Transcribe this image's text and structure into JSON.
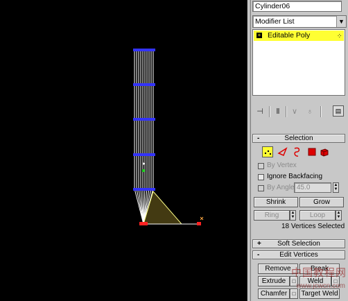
{
  "object_name": "Cylinder06",
  "modifier_list": {
    "label": "Modifier List",
    "arrow": "▼"
  },
  "stack": {
    "items": [
      {
        "label": "Editable Poly",
        "selected": true
      }
    ]
  },
  "stack_tools": {
    "pin": "⊣",
    "show_end": "Ⅱ",
    "unique": "∨",
    "remove": "♁",
    "configure": "▤"
  },
  "rollouts": {
    "selection": {
      "sign": "-",
      "title": "Selection",
      "subobject_icons": [
        "vertex-icon",
        "edge-icon",
        "border-icon",
        "polygon-icon",
        "element-icon"
      ],
      "by_vertex": "By Vertex",
      "ignore_backfacing": "Ignore Backfacing",
      "by_angle": "By Angle:",
      "angle_value": "45.0",
      "shrink": "Shrink",
      "grow": "Grow",
      "ring": "Ring",
      "loop": "Loop",
      "status": "18 Vertices Selected"
    },
    "soft_selection": {
      "sign": "+",
      "title": "Soft Selection"
    },
    "edit_vertices": {
      "sign": "-",
      "title": "Edit Vertices",
      "remove": "Remove",
      "break": "Break",
      "extrude": "Extrude",
      "weld": "Weld",
      "chamfer": "Chamfer",
      "target_weld": "Target Weld"
    }
  },
  "watermark": {
    "text": "中国教程网",
    "url": "www.jcwcn.com"
  },
  "colors": {
    "accent_yellow": "#ffff33",
    "vertex_blue": "#3333ff",
    "vertex_red": "#ff2222"
  }
}
